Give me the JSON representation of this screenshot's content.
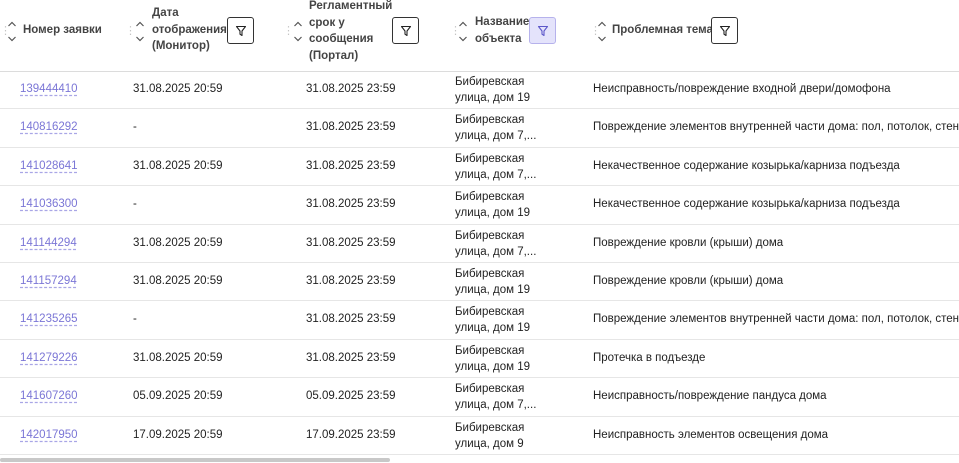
{
  "columns": [
    {
      "label": "Номер заявки"
    },
    {
      "label": "Дата\nотображения\n(Монитор)"
    },
    {
      "label": "Регламентный\nсрок у\nсообщения\n(Портал)"
    },
    {
      "label": "Название\nобъекта"
    },
    {
      "label": "Проблемная тема"
    }
  ],
  "rows": [
    {
      "id": "139444410",
      "display_date": "31.08.2025 20:59",
      "deadline": "31.08.2025 23:59",
      "object": "Бибиревская\nулица, дом 19",
      "topic": "Неисправность/повреждение входной двери/домофона"
    },
    {
      "id": "140816292",
      "display_date": "-",
      "deadline": "31.08.2025 23:59",
      "object": "Бибиревская\nулица, дом 7,...",
      "topic": "Повреждение элементов внутренней части дома: пол, потолок, стены"
    },
    {
      "id": "141028641",
      "display_date": "31.08.2025 20:59",
      "deadline": "31.08.2025 23:59",
      "object": "Бибиревская\nулица, дом 7,...",
      "topic": "Некачественное содержание козырька/карниза подъезда"
    },
    {
      "id": "141036300",
      "display_date": "-",
      "deadline": "31.08.2025 23:59",
      "object": "Бибиревская\nулица, дом 19",
      "topic": "Некачественное содержание козырька/карниза подъезда"
    },
    {
      "id": "141144294",
      "display_date": "31.08.2025 20:59",
      "deadline": "31.08.2025 23:59",
      "object": "Бибиревская\nулица, дом 7,...",
      "topic": "Повреждение кровли (крыши) дома"
    },
    {
      "id": "141157294",
      "display_date": "31.08.2025 20:59",
      "deadline": "31.08.2025 23:59",
      "object": "Бибиревская\nулица, дом 19",
      "topic": "Повреждение кровли (крыши) дома"
    },
    {
      "id": "141235265",
      "display_date": "-",
      "deadline": "31.08.2025 23:59",
      "object": "Бибиревская\nулица, дом 19",
      "topic": "Повреждение элементов внутренней части дома: пол, потолок, стены"
    },
    {
      "id": "141279226",
      "display_date": "31.08.2025 20:59",
      "deadline": "31.08.2025 23:59",
      "object": "Бибиревская\nулица, дом 19",
      "topic": "Протечка в подъезде"
    },
    {
      "id": "141607260",
      "display_date": "05.09.2025 20:59",
      "deadline": "05.09.2025 23:59",
      "object": "Бибиревская\nулица, дом 7,...",
      "topic": "Неисправность/повреждение пандуса дома"
    },
    {
      "id": "142017950",
      "display_date": "17.09.2025 20:59",
      "deadline": "17.09.2025 23:59",
      "object": "Бибиревская\nулица, дом 9",
      "topic": "Неисправность элементов освещения дома"
    }
  ],
  "colors": {
    "link": "#7b76d6",
    "active_filter_bg": "#e4e3fb",
    "border": "#dcdcdc"
  },
  "icons": {
    "drag": "drag-handle-icon",
    "sort": "sort-icon",
    "filter": "filter-icon"
  }
}
